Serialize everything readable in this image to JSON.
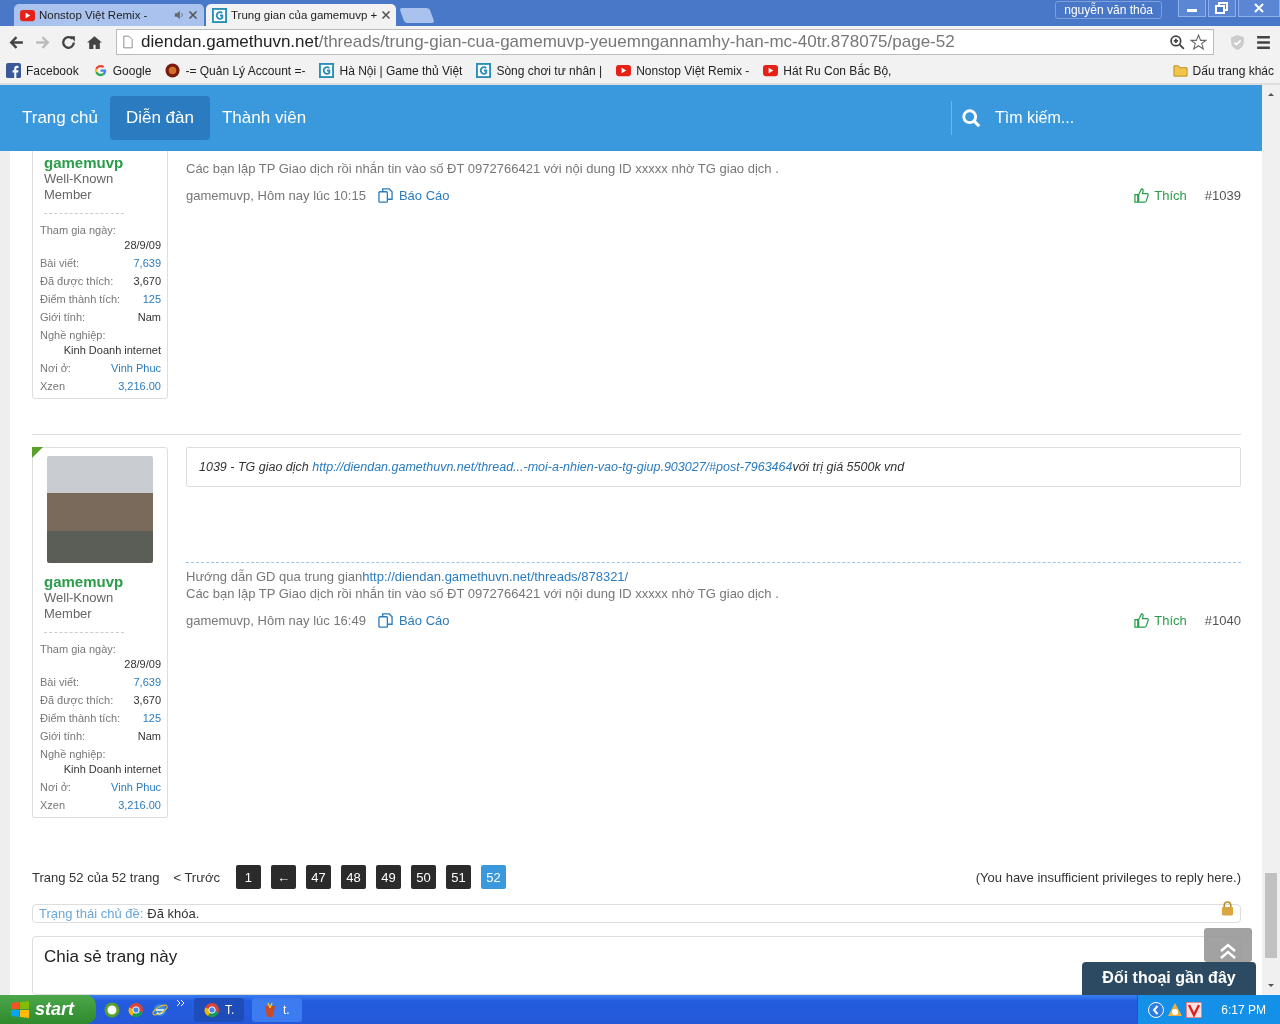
{
  "browser": {
    "tabs": [
      {
        "title": "Nonstop Việt Remix -",
        "kind": "video",
        "audio": true,
        "selected": false
      },
      {
        "title": "Trung gian của gamemuvp +",
        "kind": "forum",
        "audio": false,
        "selected": true
      }
    ],
    "profile": "nguyễn văn thỏa",
    "url": {
      "host": "diendan.gamethuvn.net",
      "path": "/threads/trung-gian-cua-gamemuvp-yeuemngannamhy-han-mc-40tr.878075/page-52"
    },
    "bookmarks": [
      {
        "label": "Facebook",
        "kind": "social"
      },
      {
        "label": "Google",
        "kind": "search"
      },
      {
        "label": "-= Quản Lý Account =-",
        "kind": "game"
      },
      {
        "label": "Hà Nội | Game thủ Việt",
        "kind": "forum"
      },
      {
        "label": "Sòng chơi tư nhân |",
        "kind": "forum"
      },
      {
        "label": "Nonstop Việt Remix -",
        "kind": "video"
      },
      {
        "label": "Hát Ru Con Bắc Bộ,",
        "kind": "video"
      }
    ],
    "other_bookmarks": "Dấu trang khác"
  },
  "site_nav": {
    "items": [
      {
        "label": "Trang chủ",
        "selected": false
      },
      {
        "label": "Diễn đàn",
        "selected": true
      },
      {
        "label": "Thành viên",
        "selected": false
      }
    ],
    "search_placeholder": "Tìm kiếm..."
  },
  "posts": [
    {
      "avatar": false,
      "username": "gamemuvp",
      "user_title": "Well-Known Member",
      "stats": [
        {
          "label": "Tham gia ngày:",
          "value": "28/9/09",
          "kind": "stacked",
          "link": false
        },
        {
          "label": "Bài viết:",
          "value": "7,639",
          "kind": "inline",
          "link": true
        },
        {
          "label": "Đã được thích:",
          "value": "3,670",
          "kind": "inline",
          "link": false
        },
        {
          "label": "Điểm thành tích:",
          "value": "125",
          "kind": "inline",
          "link": true
        },
        {
          "label": "Giới tính:",
          "value": "Nam",
          "kind": "inline",
          "link": false
        },
        {
          "label": "Nghề nghiệp:",
          "value": "Kinh Doanh internet",
          "kind": "stacked",
          "link": false
        },
        {
          "label": "Nơi ở:",
          "value": "Vinh Phuc",
          "kind": "inline",
          "link": true
        },
        {
          "label": "Xzen",
          "value": "3,216.00",
          "kind": "inline",
          "link": true
        }
      ],
      "signature": {
        "lines": [
          {
            "text": "Các bạn lập TP Giao dịch rồi nhắn tin vào số ĐT 0972766421 với nội dung ID xxxxx nhờ TG giao dịch ."
          }
        ]
      },
      "meta": {
        "author_time": "gamemuvp, Hôm nay lúc 10:15",
        "report": "Báo Cáo",
        "like": "Thích",
        "number": "#1039"
      }
    },
    {
      "avatar": true,
      "username": "gamemuvp",
      "user_title": "Well-Known Member",
      "stats": [
        {
          "label": "Tham gia ngày:",
          "value": "28/9/09",
          "kind": "stacked",
          "link": false
        },
        {
          "label": "Bài viết:",
          "value": "7,639",
          "kind": "inline",
          "link": true
        },
        {
          "label": "Đã được thích:",
          "value": "3,670",
          "kind": "inline",
          "link": false
        },
        {
          "label": "Điểm thành tích:",
          "value": "125",
          "kind": "inline",
          "link": true
        },
        {
          "label": "Giới tính:",
          "value": "Nam",
          "kind": "inline",
          "link": false
        },
        {
          "label": "Nghề nghiệp:",
          "value": "Kinh Doanh internet",
          "kind": "stacked",
          "link": false
        },
        {
          "label": "Nơi ở:",
          "value": "Vinh Phuc",
          "kind": "inline",
          "link": true
        },
        {
          "label": "Xzen",
          "value": "3,216.00",
          "kind": "inline",
          "link": true
        }
      ],
      "quote": {
        "before": "1039 - TG giao dịch",
        "link": "http://diendan.gamethuvn.net/thread...-moi-a-nhien-vao-tg-giup.903027/#post-7963464",
        "after": "với trị giá 5500k vnd"
      },
      "signature": {
        "lines": [
          {
            "text": "Hướng dẫn GD qua trung gian",
            "link": "http://diendan.gamethuvn.net/threads/878321/"
          },
          {
            "text": "Các bạn lập TP Giao dịch rồi nhắn tin vào số ĐT 0972766421 với nội dung ID xxxxx nhờ TG giao dịch ."
          }
        ]
      },
      "meta": {
        "author_time": "gamemuvp, Hôm nay lúc 16:49",
        "report": "Báo Cáo",
        "like": "Thích",
        "number": "#1040"
      }
    }
  ],
  "pagination": {
    "summary": "Trang 52 của 52 trang",
    "prev": "< Trước",
    "pages": [
      {
        "label": "1",
        "selected": false
      },
      {
        "label": "←",
        "selected": false
      },
      {
        "label": "47",
        "selected": false
      },
      {
        "label": "48",
        "selected": false
      },
      {
        "label": "49",
        "selected": false
      },
      {
        "label": "50",
        "selected": false
      },
      {
        "label": "51",
        "selected": false
      },
      {
        "label": "52",
        "selected": true
      }
    ],
    "notice": "(You have insufficient privileges to reply here.)"
  },
  "thread_status": {
    "label": "Trạng thái chủ đề:",
    "value": "Đã khóa."
  },
  "share": {
    "title": "Chia sẻ trang này"
  },
  "recent_chats": "Đối thoại gần đây",
  "taskbar": {
    "start": "start",
    "tasks": [
      {
        "label": "T.",
        "kind": "browser",
        "selected": true
      },
      {
        "label": "t.",
        "kind": "app",
        "selected": false
      }
    ],
    "clock": "6:17 PM"
  }
}
